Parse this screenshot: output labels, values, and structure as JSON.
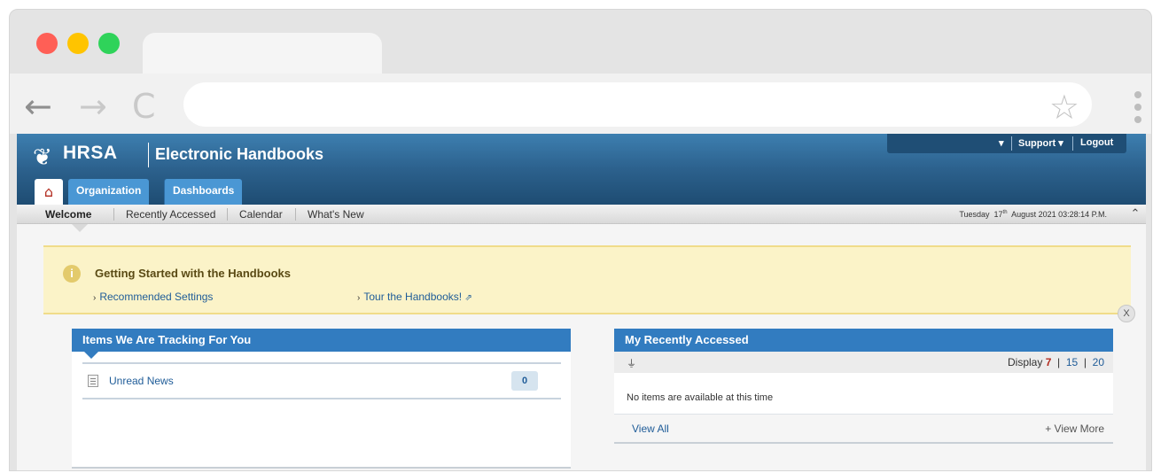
{
  "browser": {
    "back_icon": "←",
    "forward_icon": "→",
    "reload_icon": "C",
    "bookmark_icon": "☆",
    "url": ""
  },
  "header": {
    "logo_text": "HRSA",
    "app_title": "Electronic Handbooks",
    "top_menu": {
      "dropdown_caret": "▾",
      "support": "Support ▾",
      "logout": "Logout"
    },
    "home_icon": "home-icon",
    "tabs": [
      {
        "label": "Organization"
      },
      {
        "label": "Dashboards"
      }
    ]
  },
  "subnav": {
    "items": [
      {
        "label": "Welcome",
        "active": true
      },
      {
        "label": "Recently Accessed"
      },
      {
        "label": "Calendar"
      },
      {
        "label": "What's New"
      }
    ],
    "datetime": {
      "weekday": "Tuesday",
      "day": "17",
      "day_suffix": "th",
      "rest": "August  2021  03:28:14  P.M."
    },
    "collapse_icon": "⌃"
  },
  "notice": {
    "icon": "i",
    "title": "Getting Started with the Handbooks",
    "links": [
      {
        "label": "Recommended Settings"
      },
      {
        "label": "Tour the Handbooks!",
        "external": true
      }
    ],
    "close_label": "X"
  },
  "tracking_panel": {
    "title": "Items We Are Tracking For You",
    "rows": [
      {
        "label": "Unread News",
        "count": "0"
      }
    ]
  },
  "recent_panel": {
    "title": "My Recently Accessed",
    "filter_icon": "filter-icon",
    "display_label": "Display",
    "display_options": [
      "7",
      "15",
      "20"
    ],
    "display_selected": "7",
    "empty_message": "No items are available at this time",
    "view_all": "View All",
    "view_more": "+ View More"
  }
}
